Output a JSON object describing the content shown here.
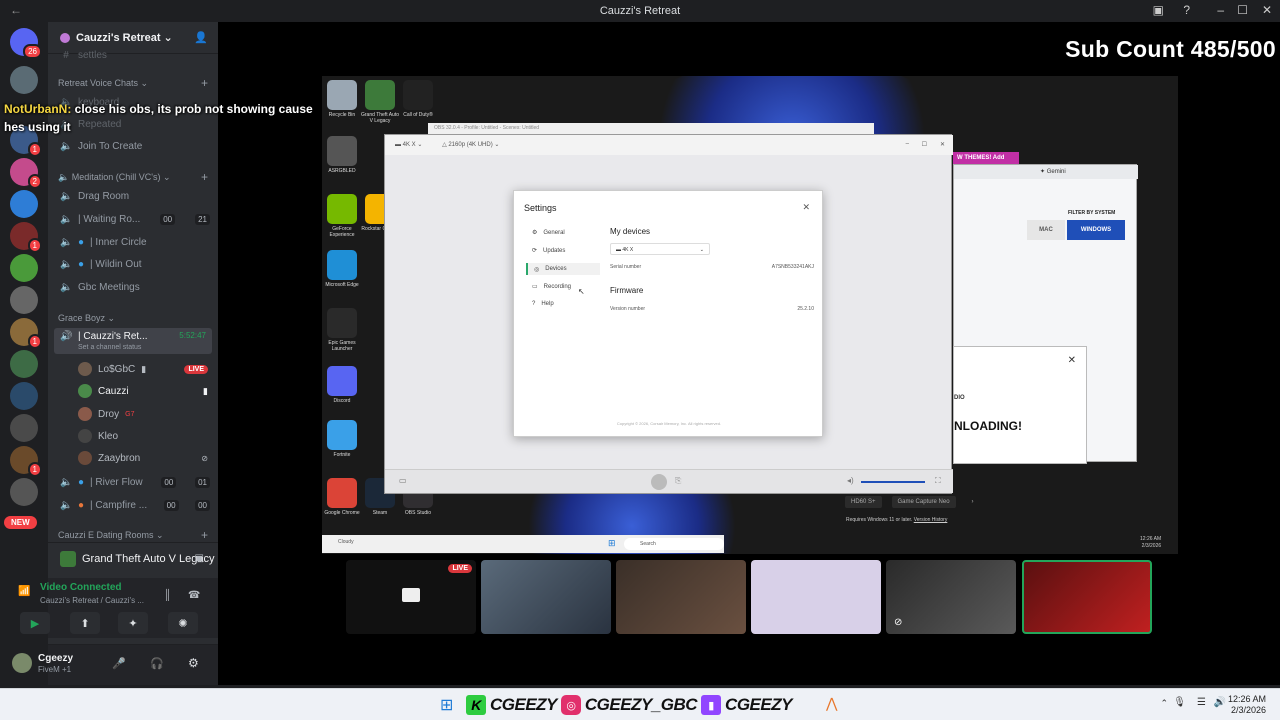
{
  "window": {
    "title": "Cauzzi's Retreat"
  },
  "server": {
    "name": "Cauzzi's Retreat",
    "rail_badge": "26",
    "new_label": "NEW",
    "rail_badges": [
      "1",
      "2",
      "1",
      "1",
      "1"
    ]
  },
  "sidebar": {
    "partial_top": "settles",
    "categories": [
      {
        "label": "Retreat Voice Chats"
      },
      {
        "label": "Meditation (Chill VC's)"
      },
      {
        "label": "Grace Boyz"
      },
      {
        "label": "Cauzzi E Dating Rooms"
      }
    ],
    "channels": {
      "keyboard": "keyboard",
      "repeated": "Repeated",
      "join_to_create": "Join To Create",
      "drag_room": "Drag Room",
      "waiting_room": "| Waiting Ro...",
      "waiting_count_a": "00",
      "waiting_count_b": "21",
      "inner_circle": "| Inner Circle",
      "wildin_out": "| Wildin Out",
      "gbc_meetings": "Gbc Meetings",
      "cauzzi_retreat": "| Cauzzi's Ret...",
      "cauzzi_retreat_time": "5:52:47",
      "channel_status": "Set a channel status",
      "river_flow": "| River Flow",
      "river_a": "00",
      "river_b": "01",
      "campfire": "| Campfire ...",
      "campfire_a": "00",
      "campfire_b": "00"
    },
    "users": [
      {
        "name": "Lo$GbC",
        "live": "LIVE"
      },
      {
        "name": "Cauzzi"
      },
      {
        "name": "Droy",
        "tag": "G7"
      },
      {
        "name": "Kleo"
      },
      {
        "name": "Zaaybron"
      }
    ],
    "activity": "Grand Theft Auto V Legacy",
    "voice": {
      "status": "Video Connected",
      "location": "Cauzzi's Retreat / Cauzzi's ..."
    },
    "me": {
      "name": "Cgeezy",
      "status": "FiveM +1"
    }
  },
  "chat_overlay": {
    "user": "NotUrbanN:",
    "message": " close his obs, its prob not showing cause hes using it"
  },
  "stream": {
    "sub_count": "Sub Count 485/500"
  },
  "desktop_icons": [
    {
      "label": "Recycle Bin",
      "color": "#9aa7b3"
    },
    {
      "label": "Grand Theft Auto V Legacy",
      "color": "#3d7a3a"
    },
    {
      "label": "Call of Duty®",
      "color": "#222222"
    },
    {
      "label": "ASRGBLED",
      "color": "#555555"
    },
    {
      "label": "GeForce Experience",
      "color": "#76b900"
    },
    {
      "label": "Rockstar Games",
      "color": "#f4b400"
    },
    {
      "label": "Microsoft Edge",
      "color": "#1f8fd6"
    },
    {
      "label": "Epic Games Launcher",
      "color": "#2a2a2a"
    },
    {
      "label": "Discord",
      "color": "#5865f2"
    },
    {
      "label": "Fortnite",
      "color": "#3aa0e8"
    },
    {
      "label": "Google Chrome",
      "color": "#db4437"
    },
    {
      "label": "Steam",
      "color": "#1b2838"
    },
    {
      "label": "OBS Studio",
      "color": "#302e31"
    }
  ],
  "obs": {
    "title": "OBS 32.0.4 - Profile: Untitled - Scenes: Untitled",
    "source": "4K X",
    "resolution": "2160p (4K UHD)"
  },
  "settings": {
    "title": "Settings",
    "nav": [
      "General",
      "Updates",
      "Devices",
      "Recording",
      "Help"
    ],
    "my_devices": "My devices",
    "device": "4K X",
    "serial_label": "Serial number",
    "serial_value": "A7SNB533241AKJ",
    "firmware": "Firmware",
    "version_label": "Version number",
    "version_value": "25.2.10",
    "copyright": "Copyright © 2026, Corsair Memory, Inc. All rights reserved."
  },
  "browser": {
    "tab_label": "Gemini",
    "pink_banner": "W THEMES! Add",
    "filter_label": "FILTER BY SYSTEM",
    "mac": "MAC",
    "windows": "WINDOWS",
    "popup_studio": "DIO",
    "popup_downloading": "NLOADING!",
    "tags": [
      "HD60 S+",
      "Game Capture Neo"
    ],
    "requirements": "Requires Windows 11 or later.",
    "version_history": "Version History"
  },
  "inner_taskbar": {
    "search": "Search",
    "weather": "Cloudy",
    "time": "12:26 AM",
    "date": "2/3/2026"
  },
  "tiles": [
    {
      "live": "LIVE"
    }
  ],
  "banner": {
    "handle1": "CGEEZY",
    "handle2": "CGEEZY_GBC",
    "handle3": "CGEEZY"
  },
  "tray": {
    "time": "12:26 AM",
    "date": "2/3/2026"
  }
}
